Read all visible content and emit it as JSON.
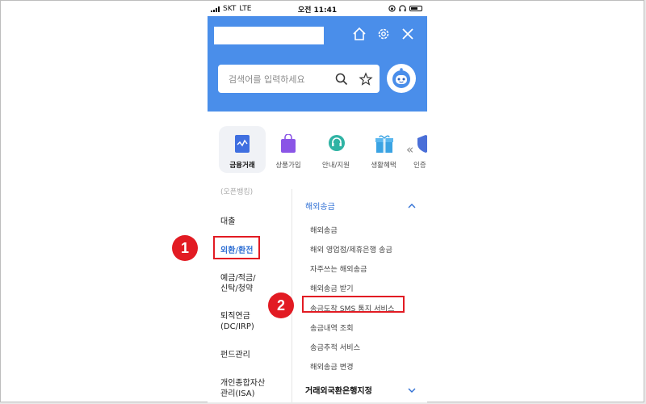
{
  "status_bar": {
    "carrier": "SKT",
    "network": "LTE",
    "time": "오전 11:41"
  },
  "header": {
    "title": ""
  },
  "search": {
    "placeholder": "검색어를 입력하세요"
  },
  "categories": [
    {
      "label": "금융거래",
      "icon": "finance-card-icon",
      "color": "#3f6fe0",
      "active": true
    },
    {
      "label": "상품가입",
      "icon": "shopping-bag-icon",
      "color": "#8a55e6"
    },
    {
      "label": "안내/지원",
      "icon": "headset-icon",
      "color": "#2fb3a4"
    },
    {
      "label": "생활혜택",
      "icon": "gift-icon",
      "color": "#3aa3e3"
    },
    {
      "label": "인증",
      "icon": "shield-icon",
      "color": "#4a6fd8"
    }
  ],
  "left_menu": {
    "partial": "(오픈뱅킹)",
    "items": [
      "대출",
      "외환/환전",
      "예금/적금/\n신탁/청약",
      "퇴직연금\n(DC/IRP)",
      "펀드관리",
      "개인종합자산\n관리(ISA)"
    ]
  },
  "right_menu": {
    "section_title": "해외송금",
    "items": [
      "해외송금",
      "해외 영업점/제휴은행 송금",
      "자주쓰는 해외송금",
      "해외송금 받기",
      "송금도착 SMS 통지 서비스",
      "송금내역 조회",
      "송금추적 서비스",
      "해외송금 변경"
    ],
    "next_section": "거래외국환은행지정"
  },
  "annotations": {
    "step1": "1",
    "step2": "2"
  },
  "colors": {
    "brand_blue": "#4a8eea",
    "highlight_red": "#e21b23",
    "active_text": "#2f6fd4"
  }
}
